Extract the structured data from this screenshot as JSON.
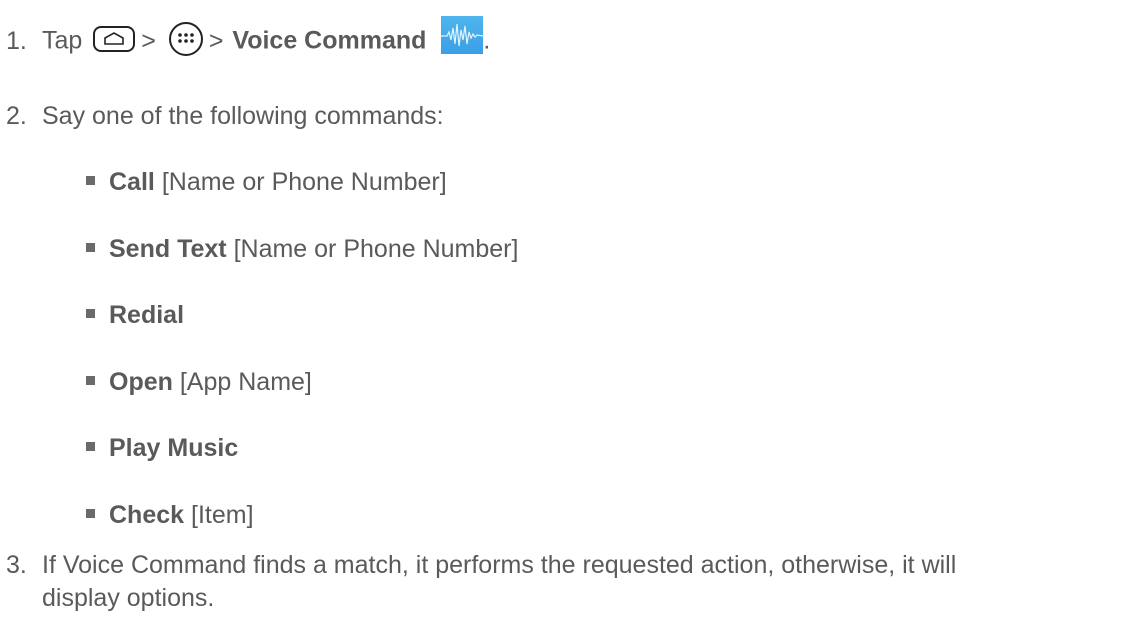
{
  "steps": [
    {
      "number": "1.",
      "prefix": "Tap",
      "separator_1": ">",
      "separator_2": ">",
      "target": "Voice Command",
      "suffix": "."
    },
    {
      "number": "2.",
      "text": "Say one of the following commands:"
    },
    {
      "number": "3.",
      "text_line_1": "If Voice Command finds a match, it performs the requested action, otherwise, it will",
      "text_line_2": "display options."
    }
  ],
  "commands": [
    {
      "keyword": "Call",
      "argument": "[Name or Phone Number]"
    },
    {
      "keyword": "Send Text",
      "argument": "[Name or Phone Number]"
    },
    {
      "keyword": "Redial",
      "argument": ""
    },
    {
      "keyword": "Open",
      "argument": "[App Name]"
    },
    {
      "keyword": "Play Music",
      "argument": ""
    },
    {
      "keyword": "Check",
      "argument": "[Item]"
    }
  ],
  "icons": {
    "home": "home-key-icon",
    "apps": "apps-icon",
    "voice": "voice-command-icon"
  },
  "colors": {
    "text": "#5a5a5a",
    "voice_icon": "#3a9ee6"
  }
}
